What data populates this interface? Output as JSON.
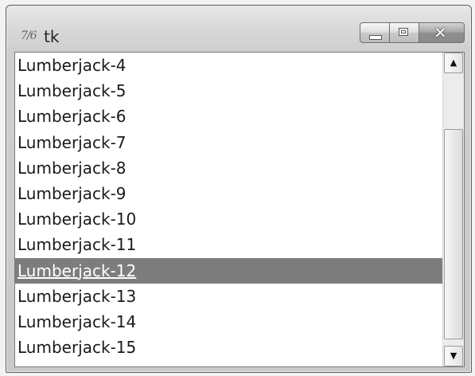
{
  "window": {
    "app_icon_glyph": "7/6",
    "title": "tk",
    "buttons": {
      "minimize": "minimize",
      "maximize": "maximize",
      "close": "✕"
    }
  },
  "listbox": {
    "items": [
      "Lumberjack-4",
      "Lumberjack-5",
      "Lumberjack-6",
      "Lumberjack-7",
      "Lumberjack-8",
      "Lumberjack-9",
      "Lumberjack-10",
      "Lumberjack-11",
      "Lumberjack-12",
      "Lumberjack-13",
      "Lumberjack-14",
      "Lumberjack-15"
    ],
    "selected_index": 8
  },
  "scrollbar": {
    "up_glyph": "▲",
    "down_glyph": "▼"
  },
  "colors": {
    "selection_background": "#7d7d7d",
    "selection_text": "#ffffff",
    "list_background": "#ffffff"
  }
}
